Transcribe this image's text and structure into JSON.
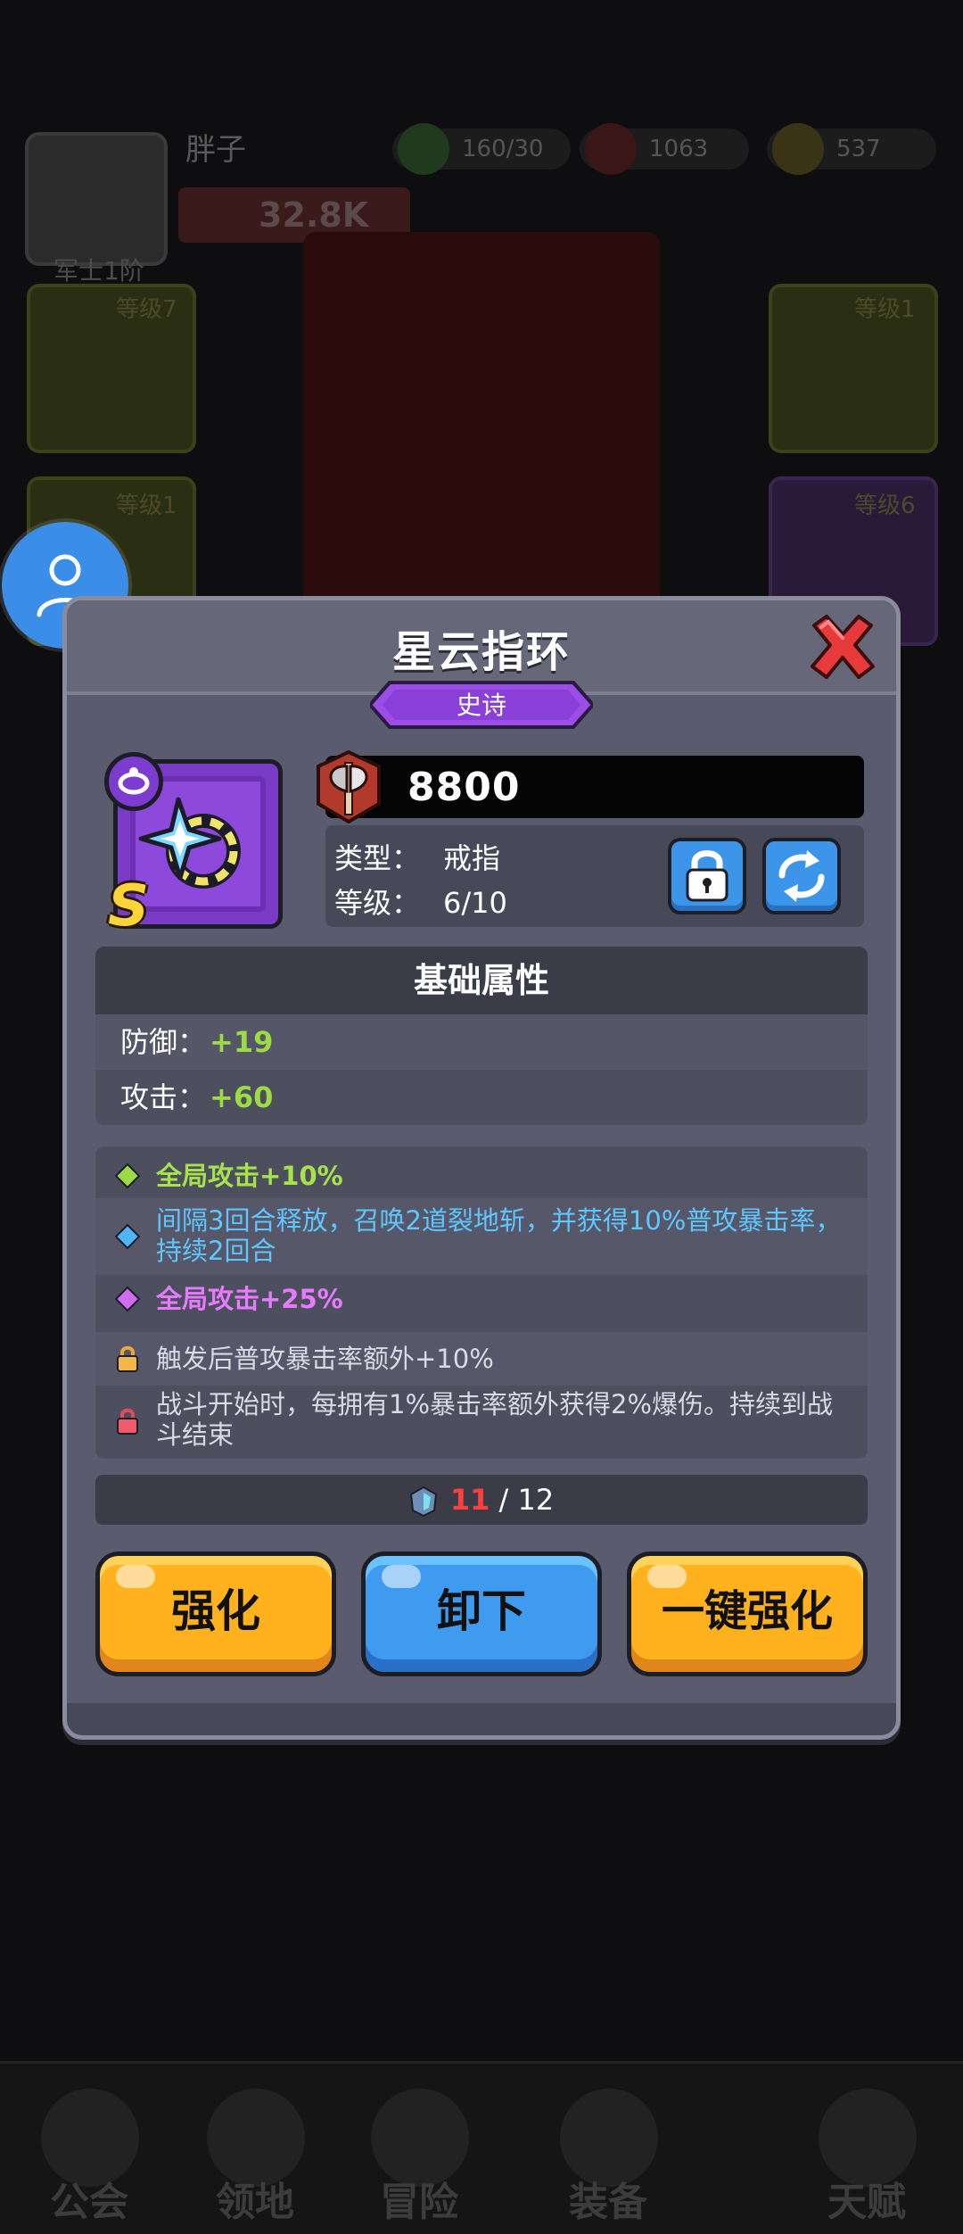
{
  "player": {
    "name": "胖子",
    "rank": "军士1阶",
    "power": "32.8K"
  },
  "resources": [
    {
      "icon": "energy-icon",
      "value": "160/30"
    },
    {
      "icon": "gem-icon",
      "value": "1063"
    },
    {
      "icon": "coin-icon",
      "value": "537"
    }
  ],
  "slots": [
    "等级7",
    "等级1",
    "等级1",
    "等级6"
  ],
  "bottom_nav": [
    "公会",
    "领地",
    "冒险",
    "装备",
    "天赋"
  ],
  "modal": {
    "title": "星云指环",
    "rarity": "史诗",
    "grade": "S",
    "power": "8800",
    "type_label": "类型：",
    "type_value": "戒指",
    "level_label": "等级：",
    "level_value": "6/10",
    "base_attr_title": "基础属性",
    "attrs": [
      {
        "label": "防御：",
        "value": "+19"
      },
      {
        "label": "攻击：",
        "value": "+60"
      }
    ],
    "effects": [
      {
        "text": "全局攻击+10%",
        "marker": "diamond-green-icon"
      },
      {
        "text": "间隔3回合释放，召唤2道裂地斩，并获得10%普攻暴击率，持续2回合",
        "marker": "diamond-blue-icon"
      },
      {
        "text": "全局攻击+25%",
        "marker": "diamond-purple-icon"
      },
      {
        "text": "触发后普攻暴击率额外+10%",
        "marker": "lock-gold-icon"
      },
      {
        "text": "战斗开始时，每拥有1%暴击率额外获得2%爆伤。持续到战斗结束",
        "marker": "lock-red-icon"
      }
    ],
    "progress_current": "11",
    "progress_total": " / 12",
    "buttons": {
      "enhance": "强化",
      "unequip": "卸下",
      "auto_enhance": "一键强化"
    }
  },
  "colors": {
    "accent_green": "#9ddb45",
    "accent_blue": "#5fc7ff",
    "accent_purple": "#e67bff",
    "button_yellow": "#ffb21e",
    "button_blue": "#3f9bf0"
  }
}
